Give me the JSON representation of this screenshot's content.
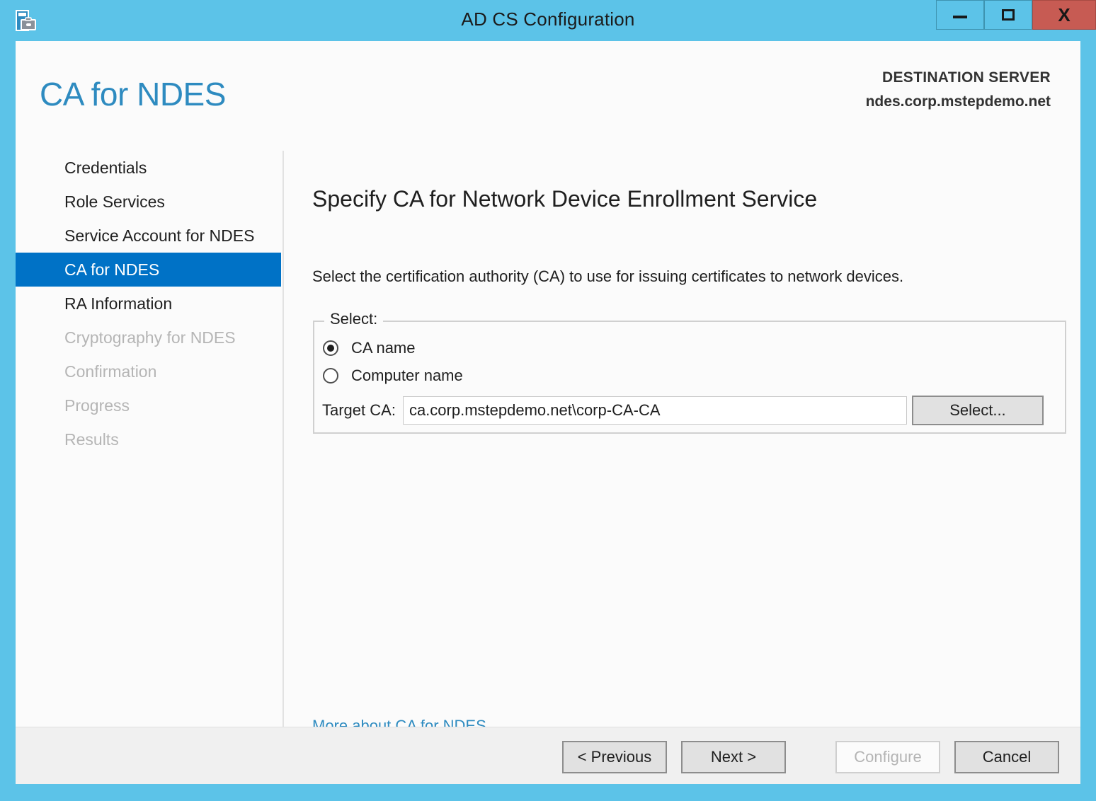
{
  "window": {
    "title": "AD CS Configuration",
    "icon": "adcs-config-icon",
    "controls": {
      "minimize": "minimize-icon",
      "maximize": "maximize-icon",
      "close": "X"
    },
    "accent_color": "#5cc3e8",
    "close_color": "#c75b53"
  },
  "header": {
    "title": "CA for NDES",
    "destination_label": "DESTINATION SERVER",
    "destination_server": "ndes.corp.mstepdemo.net",
    "title_color": "#2e8bc0"
  },
  "sidebar": {
    "selected_color": "#0072c6",
    "items": [
      {
        "label": "Credentials",
        "state": "enabled"
      },
      {
        "label": "Role Services",
        "state": "enabled"
      },
      {
        "label": "Service Account for NDES",
        "state": "enabled"
      },
      {
        "label": "CA for NDES",
        "state": "selected"
      },
      {
        "label": "RA Information",
        "state": "enabled"
      },
      {
        "label": "Cryptography for NDES",
        "state": "disabled"
      },
      {
        "label": "Confirmation",
        "state": "disabled"
      },
      {
        "label": "Progress",
        "state": "disabled"
      },
      {
        "label": "Results",
        "state": "disabled"
      }
    ]
  },
  "main": {
    "heading": "Specify CA for Network Device Enrollment Service",
    "description": "Select the certification authority (CA) to use for issuing certificates to network devices.",
    "groupbox": {
      "legend": "Select:",
      "radios": [
        {
          "label": "CA name",
          "checked": true
        },
        {
          "label": "Computer name",
          "checked": false
        }
      ],
      "target_ca_label": "Target CA:",
      "target_ca_value": "ca.corp.mstepdemo.net\\corp-CA-CA",
      "target_ca_placeholder": "",
      "select_button": "Select..."
    },
    "more_link": "More about CA for NDES"
  },
  "footer": {
    "buttons": [
      {
        "label": "< Previous",
        "state": "enabled"
      },
      {
        "label": "Next >",
        "state": "enabled"
      },
      {
        "label": "Configure",
        "state": "disabled"
      },
      {
        "label": "Cancel",
        "state": "enabled"
      }
    ]
  }
}
